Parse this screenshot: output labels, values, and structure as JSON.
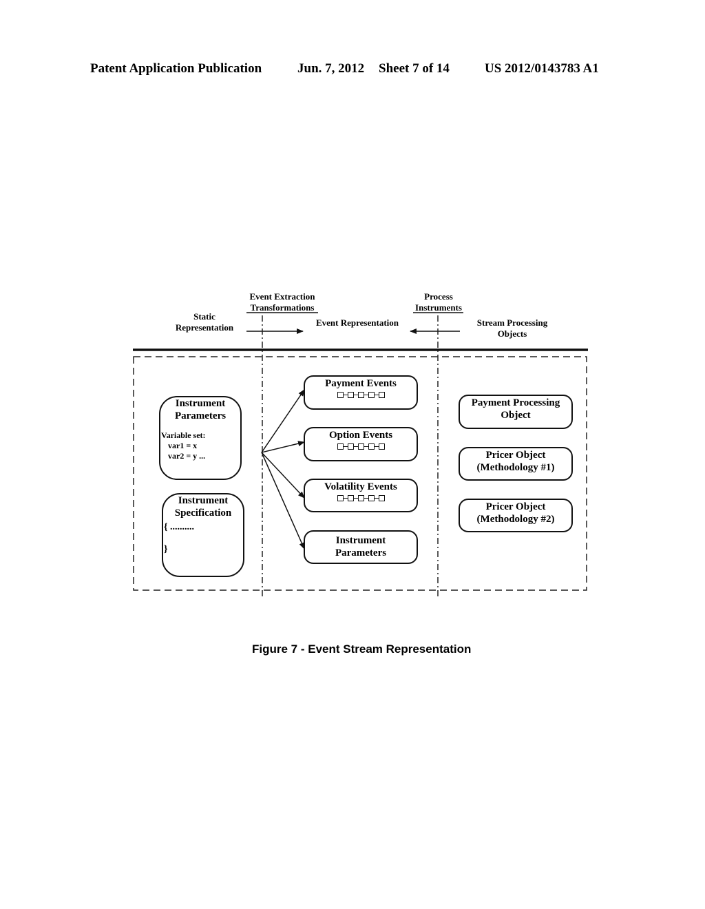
{
  "header": {
    "publication": "Patent Application Publication",
    "date": "Jun. 7, 2012",
    "sheet": "Sheet 7 of 14",
    "patent_number": "US 2012/0143783 A1"
  },
  "diagram": {
    "phase_labels": {
      "static_line1": "Static",
      "static_line2": "Representation",
      "extraction_line1": "Event Extraction",
      "extraction_line2": "Transformations",
      "event_representation": "Event Representation",
      "process_line1": "Process",
      "process_line2": "Instruments",
      "stream_line1": "Stream Processing",
      "stream_line2": "Objects"
    },
    "left_boxes": {
      "instrument_parameters": {
        "title_line1": "Instrument",
        "title_line2": "Parameters",
        "body_line1": "Variable set:",
        "body_line2": "var1 = x",
        "body_line3": "var2 = y ..."
      },
      "instrument_specification": {
        "title_line1": "Instrument",
        "title_line2": "Specification",
        "open_brace": "{ ..........",
        "close_brace": "}"
      }
    },
    "event_boxes": [
      {
        "label": "Payment Events",
        "has_chain": true,
        "chain_nodes": 5
      },
      {
        "label": "Option Events",
        "has_chain": true,
        "chain_nodes": 5
      },
      {
        "label": "Volatility Events",
        "has_chain": true,
        "chain_nodes": 5
      },
      {
        "label_line1": "Instrument",
        "label_line2": "Parameters",
        "has_chain": false
      }
    ],
    "object_boxes": [
      {
        "line1": "Payment Processing",
        "line2": "Object"
      },
      {
        "line1": "Pricer Object",
        "line2": "(Methodology #1)"
      },
      {
        "line1": "Pricer Object",
        "line2": "(Methodology #2)"
      }
    ]
  },
  "caption": "Figure 7 - Event Stream Representation"
}
